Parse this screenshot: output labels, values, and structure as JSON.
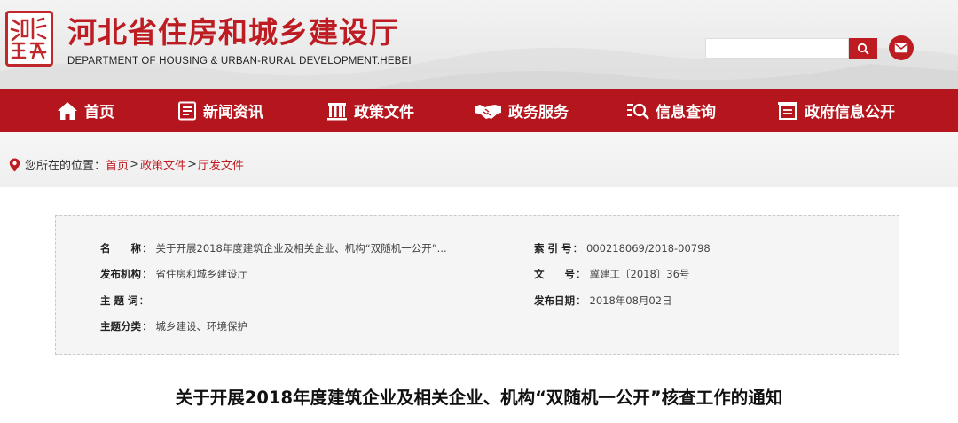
{
  "site": {
    "title": "河北省住房和城乡建设厅",
    "subtitle": "DEPARTMENT OF HOUSING & URBAN-RURAL DEVELOPMENT.HEBEI",
    "seal_text": "河北建设厅",
    "search_placeholder": "",
    "accent_color": "#b5151c"
  },
  "nav": {
    "items": [
      {
        "label": "首页",
        "icon": "home-icon"
      },
      {
        "label": "新闻资讯",
        "icon": "newspaper-icon"
      },
      {
        "label": "政策文件",
        "icon": "building-icon"
      },
      {
        "label": "政务服务",
        "icon": "handshake-icon"
      },
      {
        "label": "信息查询",
        "icon": "search-list-icon"
      },
      {
        "label": "政府信息公开",
        "icon": "document-list-icon"
      }
    ]
  },
  "breadcrumb": {
    "prefix": "您所在的位置：",
    "items": [
      "首页",
      "政策文件",
      "厅发文件"
    ],
    "separator": ">"
  },
  "info": {
    "name_label": "名　　称",
    "name_value": "关于开展2018年度建筑企业及相关企业、机构“双随机一公开”...",
    "org_label": "发布机构",
    "org_value": "省住房和城乡建设厅",
    "keywords_label": "主 题 词",
    "keywords_value": "",
    "category_label": "主题分类",
    "category_value": "城乡建设、环境保护",
    "index_label": "索 引 号",
    "index_value": "000218069/2018-00798",
    "docno_label": "文　　号",
    "docno_value": "冀建工〔2018〕36号",
    "date_label": "发布日期",
    "date_value": "2018年08月02日",
    "colon": "："
  },
  "document": {
    "title": "关于开展2018年度建筑企业及相关企业、机构“双随机一公开”核查工作的通知"
  }
}
